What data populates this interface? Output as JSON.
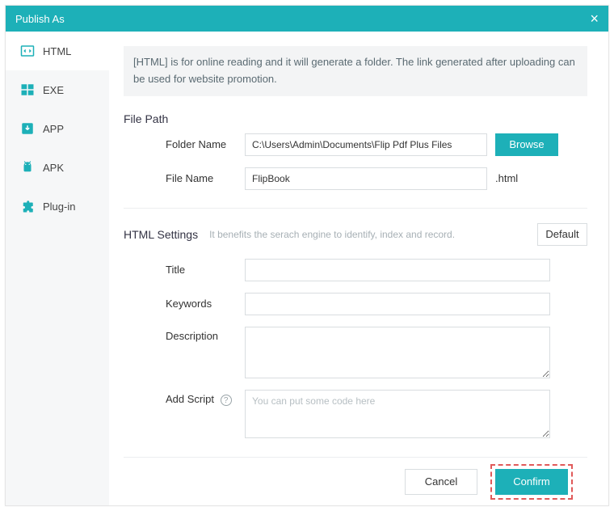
{
  "window": {
    "title": "Publish As"
  },
  "sidebar": {
    "items": [
      {
        "label": "HTML"
      },
      {
        "label": "EXE"
      },
      {
        "label": "APP"
      },
      {
        "label": "APK"
      },
      {
        "label": "Plug-in"
      }
    ]
  },
  "info": "[HTML] is for online reading and it will generate a folder. The link generated after uploading can be used for website promotion.",
  "filepath": {
    "section": "File Path",
    "folder_label": "Folder Name",
    "folder_value": "C:\\Users\\Admin\\Documents\\Flip Pdf Plus Files",
    "browse": "Browse",
    "file_label": "File Name",
    "file_value": "FlipBook",
    "ext": ".html"
  },
  "settings": {
    "heading": "HTML Settings",
    "hint": "It benefits the serach engine to identify, index and record.",
    "default_btn": "Default",
    "title_label": "Title",
    "title_value": "",
    "keywords_label": "Keywords",
    "keywords_value": "",
    "description_label": "Description",
    "description_value": "",
    "script_label": "Add Script",
    "script_value": "",
    "script_placeholder": "You can put some code here"
  },
  "footer": {
    "cancel": "Cancel",
    "confirm": "Confirm"
  }
}
